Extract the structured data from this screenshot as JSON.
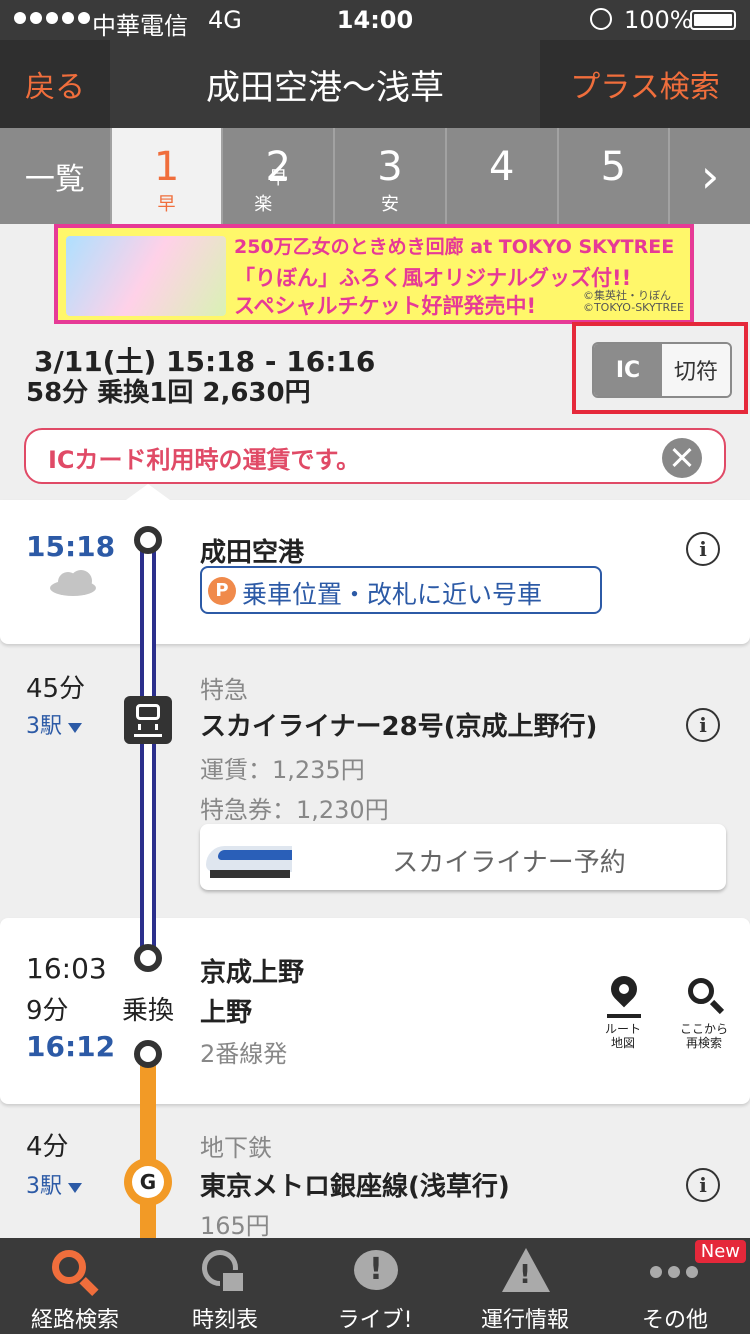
{
  "status_bar": {
    "carrier": "中華電信",
    "network": "4G",
    "time": "14:00",
    "battery": "100%"
  },
  "nav": {
    "back": "戻る",
    "title": "成田空港〜浅草",
    "plus_search": "プラス検索"
  },
  "tabs": {
    "list": "一覧",
    "routes": [
      {
        "num": "1",
        "tags": "早"
      },
      {
        "num": "2",
        "tags": "早 楽"
      },
      {
        "num": "3",
        "tags": "安"
      },
      {
        "num": "4",
        "tags": ""
      },
      {
        "num": "5",
        "tags": ""
      }
    ],
    "next": "›"
  },
  "banner": {
    "line1": "250万乙女のときめき回廊 at TOKYO SKYTREE",
    "line2": "「りぼん」ふろく風オリジナルグッズ付!!",
    "line3": "スペシャルチケット好評発売中!",
    "credit1": "©集英社・りぼん",
    "credit2": "©TOKYO-SKYTREE"
  },
  "summary": {
    "date_time": "3/11(土) 15:18 - 16:16",
    "details": "58分 乗換1回 2,630円",
    "toggle_ic": "IC",
    "toggle_ticket": "切符"
  },
  "notice": {
    "text": "ICカード利用時の運賃です。"
  },
  "route": {
    "departure": {
      "time": "15:18",
      "station": "成田空港",
      "position_icon": "P",
      "position_button": "乗車位置・改札に近い号車",
      "weather": "cloud-icon"
    },
    "leg1": {
      "duration": "45分",
      "stations": "3駅",
      "type": "特急",
      "train": "スカイライナー28号(京成上野行)",
      "fare": "運賃：1,235円",
      "express_fee": "特急券：1,230円",
      "reserve_button": "スカイライナー予約"
    },
    "transfer": {
      "arrive_time": "16:03",
      "wait": "9分",
      "label": "乗換",
      "depart_time": "16:12",
      "station1": "京成上野",
      "station2": "上野",
      "platform": "2番線発",
      "map_tool": "ルート\n地図",
      "research_tool": "ここから\n再検索"
    },
    "leg2": {
      "duration": "4分",
      "stations": "3駅",
      "type": "地下鉄",
      "line_badge": "G",
      "train": "東京メトロ銀座線(浅草行)",
      "fare": "165円"
    }
  },
  "tabbar": [
    {
      "label": "経路検索",
      "icon": "search-icon"
    },
    {
      "label": "時刻表",
      "icon": "clock-icon"
    },
    {
      "label": "ライブ!",
      "icon": "live-icon"
    },
    {
      "label": "運行情報",
      "icon": "warning-icon"
    },
    {
      "label": "その他",
      "icon": "more-icon",
      "badge": "New"
    }
  ],
  "colors": {
    "accent": "#f06e3c",
    "blue": "#2c5aa6",
    "navy_line": "#2b2f8c",
    "ginza_line": "#f29a26",
    "alert": "#e04a66"
  }
}
